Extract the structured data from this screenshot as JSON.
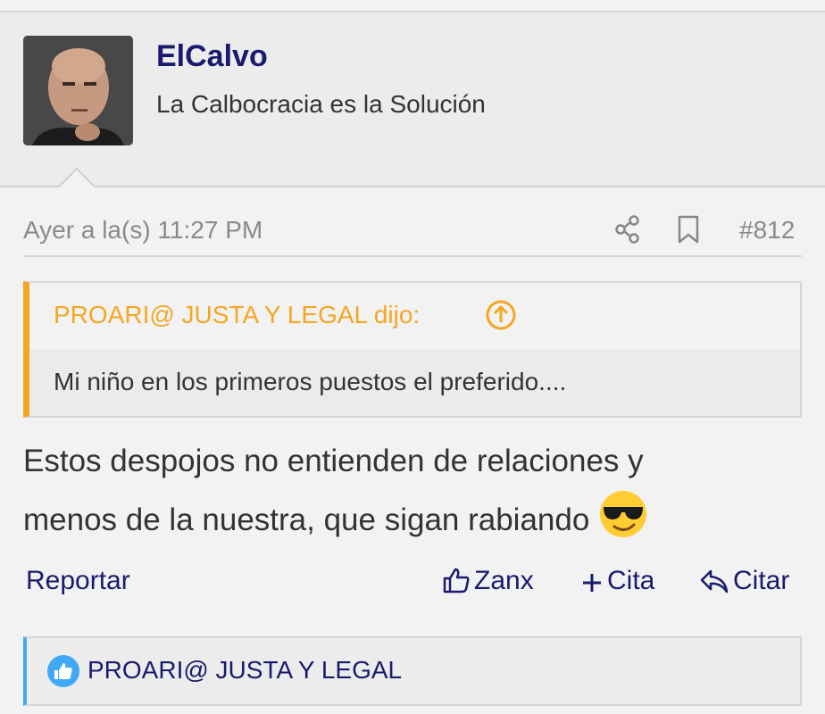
{
  "user": {
    "name": "ElCalvo",
    "title": "La Calbocracia es la Solución"
  },
  "post": {
    "timestamp": "Ayer a la(s) 11:27 PM",
    "number": "#812",
    "quote": {
      "author": "PROARI@ JUSTA Y LEGAL dijo:",
      "text": "Mi niño en los primeros puestos el preferido...."
    },
    "message_line1": "Estos despojos no entienden de relaciones y",
    "message_line2": "menos de la nuestra, que sigan rabiando"
  },
  "actions": {
    "report": "Reportar",
    "like": "Zanx",
    "multiquote": "Cita",
    "reply": "Citar"
  },
  "reactions": {
    "users": "PROARI@ JUSTA Y LEGAL"
  },
  "colors": {
    "link": "#1a1a6e",
    "quote_accent": "#f5a623",
    "reaction_accent": "#3fa9f5"
  },
  "icons": [
    "share-icon",
    "bookmark-icon",
    "arrow-up-circle-icon",
    "thumbs-up-icon",
    "plus-icon",
    "reply-icon",
    "like-badge-icon",
    "cool-emoji-icon"
  ]
}
